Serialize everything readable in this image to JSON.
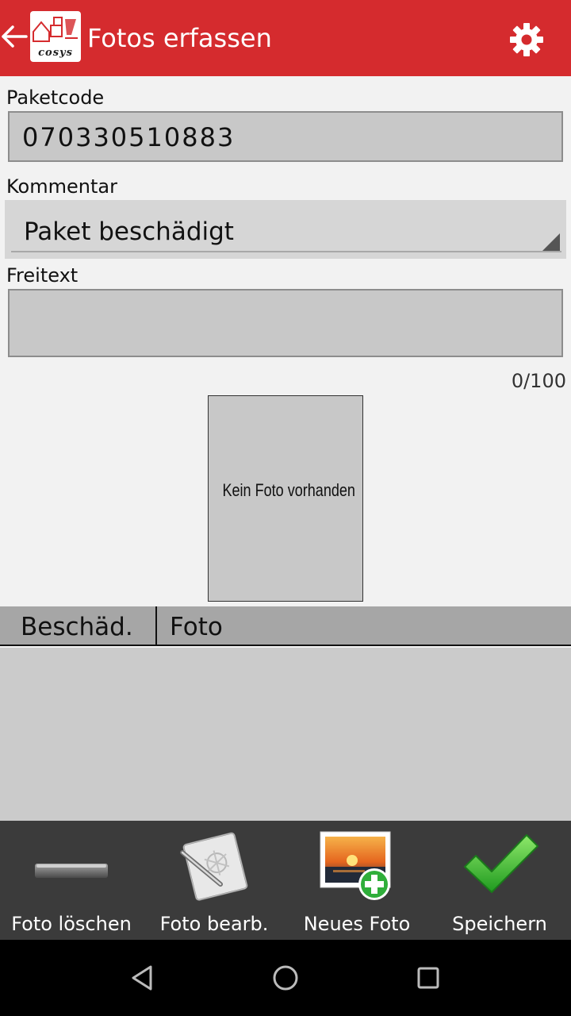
{
  "appbar": {
    "title": "Fotos erfassen",
    "logo_text": "cosys",
    "back_icon": "arrow-left-icon",
    "settings_icon": "gear-icon"
  },
  "form": {
    "paketcode_label": "Paketcode",
    "paketcode_value": "070330510883",
    "kommentar_label": "Kommentar",
    "kommentar_value": "Paket beschädigt",
    "freitext_label": "Freitext",
    "freitext_value": "",
    "counter": "0/100"
  },
  "photo": {
    "placeholder": "Kein Foto vorhanden"
  },
  "table": {
    "columns": [
      "Beschäd.",
      "Foto"
    ],
    "rows": []
  },
  "toolbar": {
    "items": [
      {
        "label": "Foto löschen",
        "icon": "minus-bar-icon"
      },
      {
        "label": "Foto bearb.",
        "icon": "edit-notebook-icon"
      },
      {
        "label": "Neues Foto",
        "icon": "add-photo-icon"
      },
      {
        "label": "Speichern",
        "icon": "checkmark-icon"
      }
    ]
  },
  "navbar": {
    "icons": [
      "back-triangle-icon",
      "home-circle-icon",
      "recents-square-icon"
    ]
  },
  "colors": {
    "appbar": "#d52b2e",
    "toolbar": "#3b3b3b",
    "field": "#c8c8c8",
    "table_header": "#a6a6a6"
  }
}
